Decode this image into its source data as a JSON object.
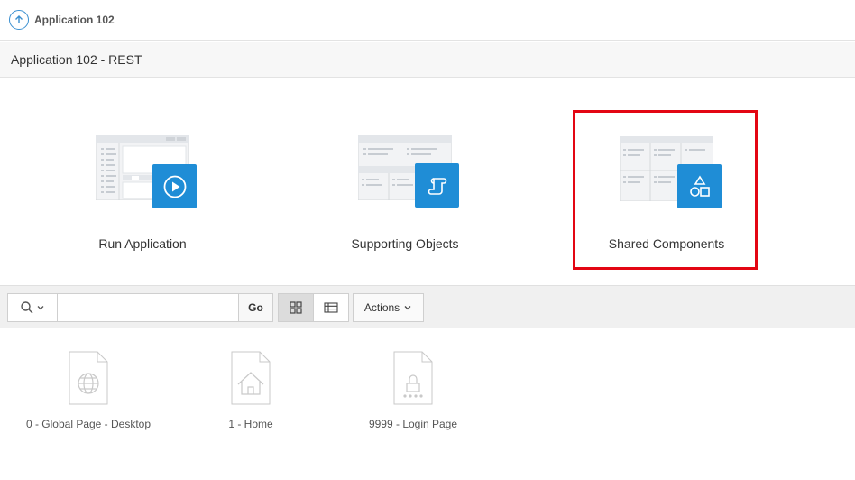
{
  "header": {
    "breadcrumb": "Application 102"
  },
  "title_bar": {
    "title": "Application 102 - REST"
  },
  "hero": {
    "items": [
      {
        "label": "Run Application",
        "icon": "play-icon"
      },
      {
        "label": "Supporting Objects",
        "icon": "scroll-icon"
      },
      {
        "label": "Shared Components",
        "icon": "shapes-icon"
      }
    ],
    "highlighted": "Shared Components"
  },
  "toolbar": {
    "search_placeholder": "",
    "search_value": "",
    "go_label": "Go",
    "actions_label": "Actions",
    "active_view": "icons"
  },
  "pages": [
    {
      "label": "0 - Global Page - Desktop",
      "icon": "globe-icon"
    },
    {
      "label": "1 - Home",
      "icon": "home-icon"
    },
    {
      "label": "9999 - Login Page",
      "icon": "lock-icon"
    }
  ],
  "colors": {
    "accent": "#1f8dd6",
    "highlight": "#e30613"
  }
}
